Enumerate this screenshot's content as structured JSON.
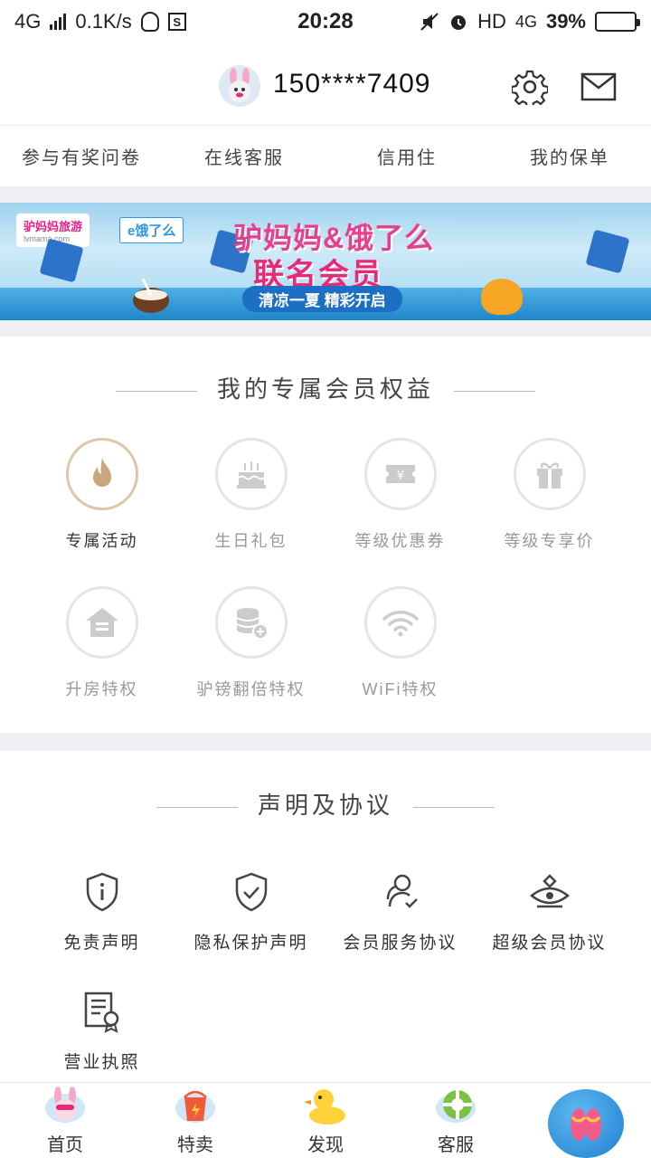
{
  "status_bar": {
    "network": "4G",
    "speed": "0.1K/s",
    "time": "20:28",
    "hd": "HD",
    "network2": "4G",
    "battery_percent": "39%",
    "battery_level": 0.39
  },
  "header": {
    "phone": "150****7409"
  },
  "quick_links": [
    "参与有奖问卷",
    "在线客服",
    "信用住",
    "我的保单"
  ],
  "banner": {
    "brand1": "驴妈妈旅游",
    "brand1_sub": "lvmama.com",
    "brand2": "饿了么",
    "title_line1": "驴妈妈&饿了么",
    "title_line2": "联名会员",
    "subtitle": "清凉一夏 精彩开启"
  },
  "benefits": {
    "title": "我的专属会员权益",
    "items": [
      {
        "label": "专属活动",
        "icon": "fire-icon",
        "active": true
      },
      {
        "label": "生日礼包",
        "icon": "cake-icon",
        "active": false
      },
      {
        "label": "等级优惠券",
        "icon": "coupon-icon",
        "active": false
      },
      {
        "label": "等级专享价",
        "icon": "gift-icon",
        "active": false
      },
      {
        "label": "升房特权",
        "icon": "house-icon",
        "active": false
      },
      {
        "label": "驴镑翻倍特权",
        "icon": "coin-stack-icon",
        "active": false
      },
      {
        "label": "WiFi特权",
        "icon": "wifi-icon",
        "active": false
      }
    ]
  },
  "agreements": {
    "title": "声明及协议",
    "items": [
      {
        "label": "免责声明",
        "icon": "shield-info-icon"
      },
      {
        "label": "隐私保护声明",
        "icon": "shield-check-icon"
      },
      {
        "label": "会员服务协议",
        "icon": "users-check-icon"
      },
      {
        "label": "超级会员协议",
        "icon": "diamond-eye-icon"
      },
      {
        "label": "营业执照",
        "icon": "certificate-icon"
      }
    ]
  },
  "tabbar": {
    "items": [
      {
        "label": "首页",
        "icon": "bunny-icon"
      },
      {
        "label": "特卖",
        "icon": "bucket-icon"
      },
      {
        "label": "发现",
        "icon": "duck-icon"
      },
      {
        "label": "客服",
        "icon": "lifebuoy-icon"
      }
    ],
    "fab_icon": "slipper-icon"
  },
  "colors": {
    "accent_gold": "#dcc7a6",
    "brand_pink": "#e8297a",
    "brand_blue": "#1d6fc4"
  }
}
